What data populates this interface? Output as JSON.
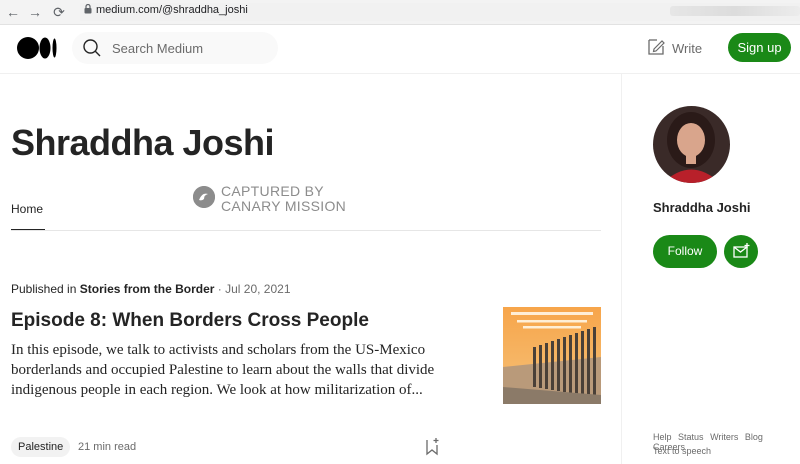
{
  "browser": {
    "url": "medium.com/@shraddha_joshi",
    "back_icon": "←",
    "forward_icon": "→",
    "reload_icon": "⟳"
  },
  "header": {
    "search_placeholder": "Search Medium",
    "write_label": "Write",
    "signup_label": "Sign up"
  },
  "profile": {
    "title": "Shraddha Joshi",
    "tab_home": "Home"
  },
  "watermark": {
    "line1": "CAPTURED BY",
    "line2": "CANARY MISSION"
  },
  "article": {
    "published_prefix": "Published in",
    "publication": "Stories from the Border",
    "date": " · Jul 20, 2021",
    "title": "Episode 8: When Borders Cross People",
    "excerpt": "In this episode, we talk to activists and scholars from the US-Mexico borderlands and occupied Palestine to learn about the walls that divide indigenous people in each region. We look at how militarization of...",
    "tag": "Palestine",
    "read_time": "21 min read"
  },
  "sidebar": {
    "name": "Shraddha Joshi",
    "follow_label": "Follow",
    "footer": {
      "help": "Help",
      "status": "Status",
      "writers": "Writers",
      "blog": "Blog",
      "careers": "Careers",
      "tts": "Text to speech"
    }
  },
  "colors": {
    "brand_green": "#1a8917",
    "text": "#242424",
    "muted": "#6b6b6b"
  }
}
